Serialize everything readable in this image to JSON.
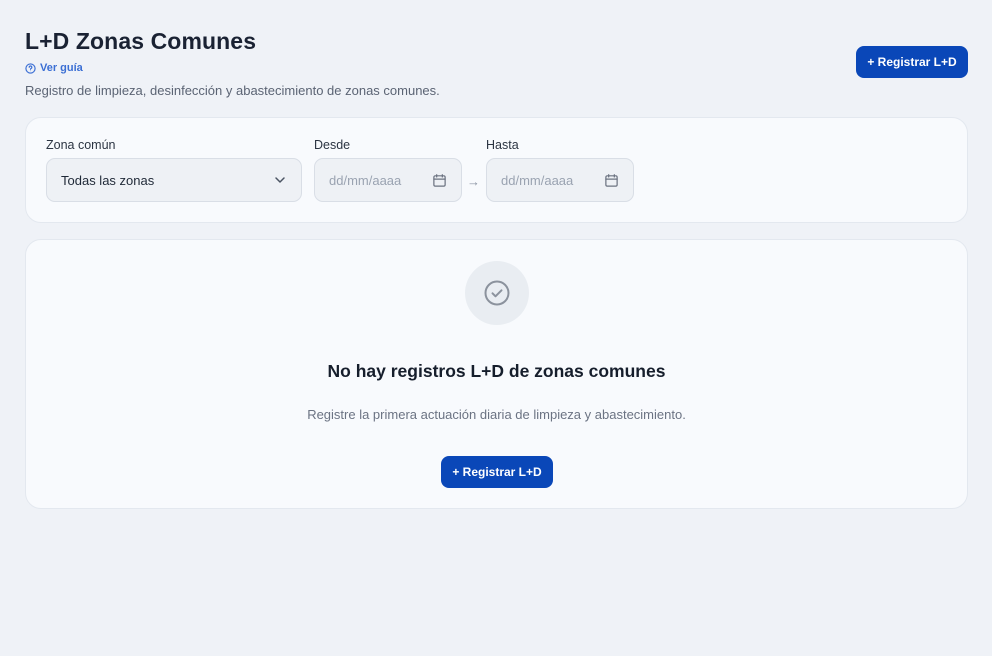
{
  "header": {
    "title": "L+D Zonas Comunes",
    "guide_label": "Ver guía",
    "subtitle": "Registro de limpieza, desinfección y abastecimiento de zonas comunes.",
    "register_button": "+ Registrar L+D"
  },
  "filters": {
    "zone_label": "Zona común",
    "zone_value": "Todas las zonas",
    "from_label": "Desde",
    "from_placeholder": "dd/mm/aaaa",
    "to_label": "Hasta",
    "to_placeholder": "dd/mm/aaaa",
    "range_separator": "→"
  },
  "empty_state": {
    "title": "No hay registros L+D de zonas comunes",
    "description": "Registre la primera actuación diaria de limpieza y abastecimiento.",
    "button": "+ Registrar L+D"
  },
  "colors": {
    "background": "#eff2f7",
    "primary": "#0a47b8",
    "link": "#3b6fd4"
  }
}
